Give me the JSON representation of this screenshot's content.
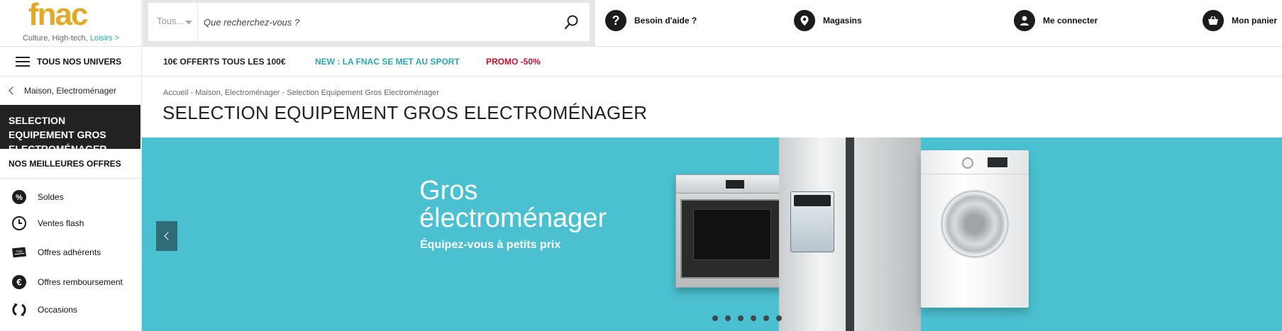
{
  "header": {
    "logo_text": "fnac",
    "tagline": "Culture, High-tech, ",
    "tagline_accent": "Loisirs >",
    "search": {
      "category": "Tous...",
      "placeholder": "Que recherchez-vous ?"
    },
    "actions": [
      {
        "label": "Besoin d'aide ?",
        "icon": "help-icon"
      },
      {
        "label": "Magasins",
        "icon": "location-pin-icon"
      },
      {
        "label": "Me connecter",
        "icon": "user-icon"
      },
      {
        "label": "Mon panier",
        "icon": "basket-icon"
      }
    ]
  },
  "navbar": {
    "univers_label": "TOUS NOS UNIVERS",
    "promos": [
      {
        "label": "10€ OFFERTS TOUS LES 100€",
        "color": "#222222"
      },
      {
        "label": "NEW : LA FNAC SE MET AU SPORT",
        "color": "#2aa7b7"
      },
      {
        "label": "PROMO -50%",
        "color": "#c8102e"
      }
    ]
  },
  "sidebar": {
    "back_label": "Maison, Electroménager",
    "current_category": "SELECTION EQUIPEMENT GROS ELECTROMÉNAGER",
    "best_offers_label": "NOS MEILLEURES OFFRES",
    "items": [
      {
        "label": "Soldes",
        "icon": "percent-icon"
      },
      {
        "label": "Ventes flash",
        "icon": "clock-icon"
      },
      {
        "label": "Offres adhérents",
        "icon": "club-card-icon"
      },
      {
        "label": "Offres remboursement",
        "icon": "euro-icon"
      },
      {
        "label": "Occasions",
        "icon": "recycle-icon"
      }
    ]
  },
  "main": {
    "breadcrumb": [
      "Accueil",
      "Maison, Electroménager",
      "Selection Equipement Gros Electroménager"
    ],
    "breadcrumb_separator": " - ",
    "page_title": "SELECTION EQUIPEMENT GROS ELECTROMÉNAGER",
    "banner": {
      "headline_line1": "Gros",
      "headline_line2": "électroménager",
      "subtitle": "Équipez-vous à petits prix",
      "background": "#4bc0d0",
      "slide_count": 6
    }
  },
  "colors": {
    "brand": "#e0a92a",
    "accent_teal": "#2aa7b7",
    "promo_red": "#c8102e",
    "dark": "#222222"
  }
}
